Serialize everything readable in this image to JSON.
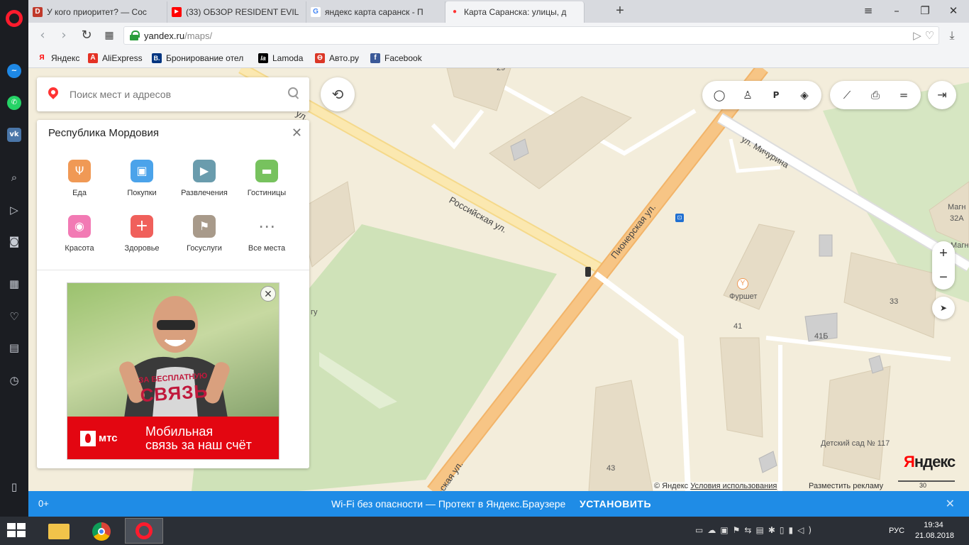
{
  "browser": {
    "tabs": [
      {
        "title": "У кого приоритет? — Coc",
        "favicon": "D",
        "favicon_color": "#c0392b"
      },
      {
        "title": "(33) ОБЗОР RESIDENT EVIL",
        "favicon": "▶",
        "favicon_color": "#ff0000"
      },
      {
        "title": "яндекс карта саранск - П",
        "favicon": "G",
        "favicon_color": "#4285f4"
      },
      {
        "title": "Карта Саранска: улицы, д",
        "favicon": "●",
        "favicon_color": "#f33"
      }
    ],
    "new_tab": "+",
    "url_host": "yandex.ru",
    "url_path": "/maps/",
    "bookmarks": [
      {
        "label": "Яндекс",
        "icon": "Я",
        "color": "#f00"
      },
      {
        "label": "AliExpress",
        "icon": "A",
        "color": "#e43225"
      },
      {
        "label": "Бронирование отел",
        "icon": "B.",
        "color": "#003580"
      },
      {
        "label": "Lamoda",
        "icon": "la",
        "color": "#000"
      },
      {
        "label": "Авто.ру",
        "icon": "⊖",
        "color": "#db3727"
      },
      {
        "label": "Facebook",
        "icon": "f",
        "color": "#3b5998"
      }
    ]
  },
  "map": {
    "search": {
      "placeholder": "Поиск мест и адресов"
    },
    "panel": {
      "title": "Республика Мордовия",
      "categories": [
        {
          "label": "Еда",
          "icon": "fork-knife-icon",
          "glyph": "Ψ",
          "color": "#f09955"
        },
        {
          "label": "Покупки",
          "icon": "shopping-bag-icon",
          "glyph": "▣",
          "color": "#4ba3ea"
        },
        {
          "label": "Развлечения",
          "icon": "camera-icon",
          "glyph": "▶",
          "color": "#6a9cad"
        },
        {
          "label": "Гостиницы",
          "icon": "bed-icon",
          "glyph": "▬",
          "color": "#77c25e"
        },
        {
          "label": "Красота",
          "icon": "lips-icon",
          "glyph": "◉",
          "color": "#f27ab4"
        },
        {
          "label": "Здоровье",
          "icon": "health-cross-icon",
          "glyph": "+",
          "color": "#f0605b"
        },
        {
          "label": "Госуслуги",
          "icon": "flag-icon",
          "glyph": "⚑",
          "color": "#a89a8a"
        },
        {
          "label": "Все места",
          "icon": "grid-dots-icon",
          "glyph": "⋯",
          "color": "#ffffff"
        }
      ]
    },
    "ad": {
      "slogan_small": "ЗА БЕСПЛАТНУЮ",
      "slogan_big": "СВЯЗЬ",
      "brand": "мтс",
      "text_line1": "Мобильная",
      "text_line2": "связь за наш счёт"
    },
    "streets": [
      "Российская ул.",
      "Пионерская ул.",
      "ул. Мичурина",
      "ул.",
      "ская ул.",
      "гу"
    ],
    "places": {
      "cafe": "Фуршет",
      "kindergarten": "Детский сад № 117",
      "shop": "Магн",
      "shop_addr": "32А",
      "shop2": "Магн"
    },
    "house_numbers": [
      "33",
      "41",
      "41Б",
      "43",
      "29"
    ],
    "copyright": "© Яндекс",
    "terms": "Условия использования",
    "ad_link": "Разместить рекламу",
    "scale": "30 м",
    "logo_left": "Я",
    "logo_right": "ндекс"
  },
  "promo": {
    "age": "0+",
    "text": "Wi-Fi без опасности — Протект в Яндекс.Браузере",
    "button": "УСТАНОВИТЬ"
  },
  "taskbar": {
    "lang": "РУС",
    "time": "19:34",
    "date": "21.08.2018"
  }
}
